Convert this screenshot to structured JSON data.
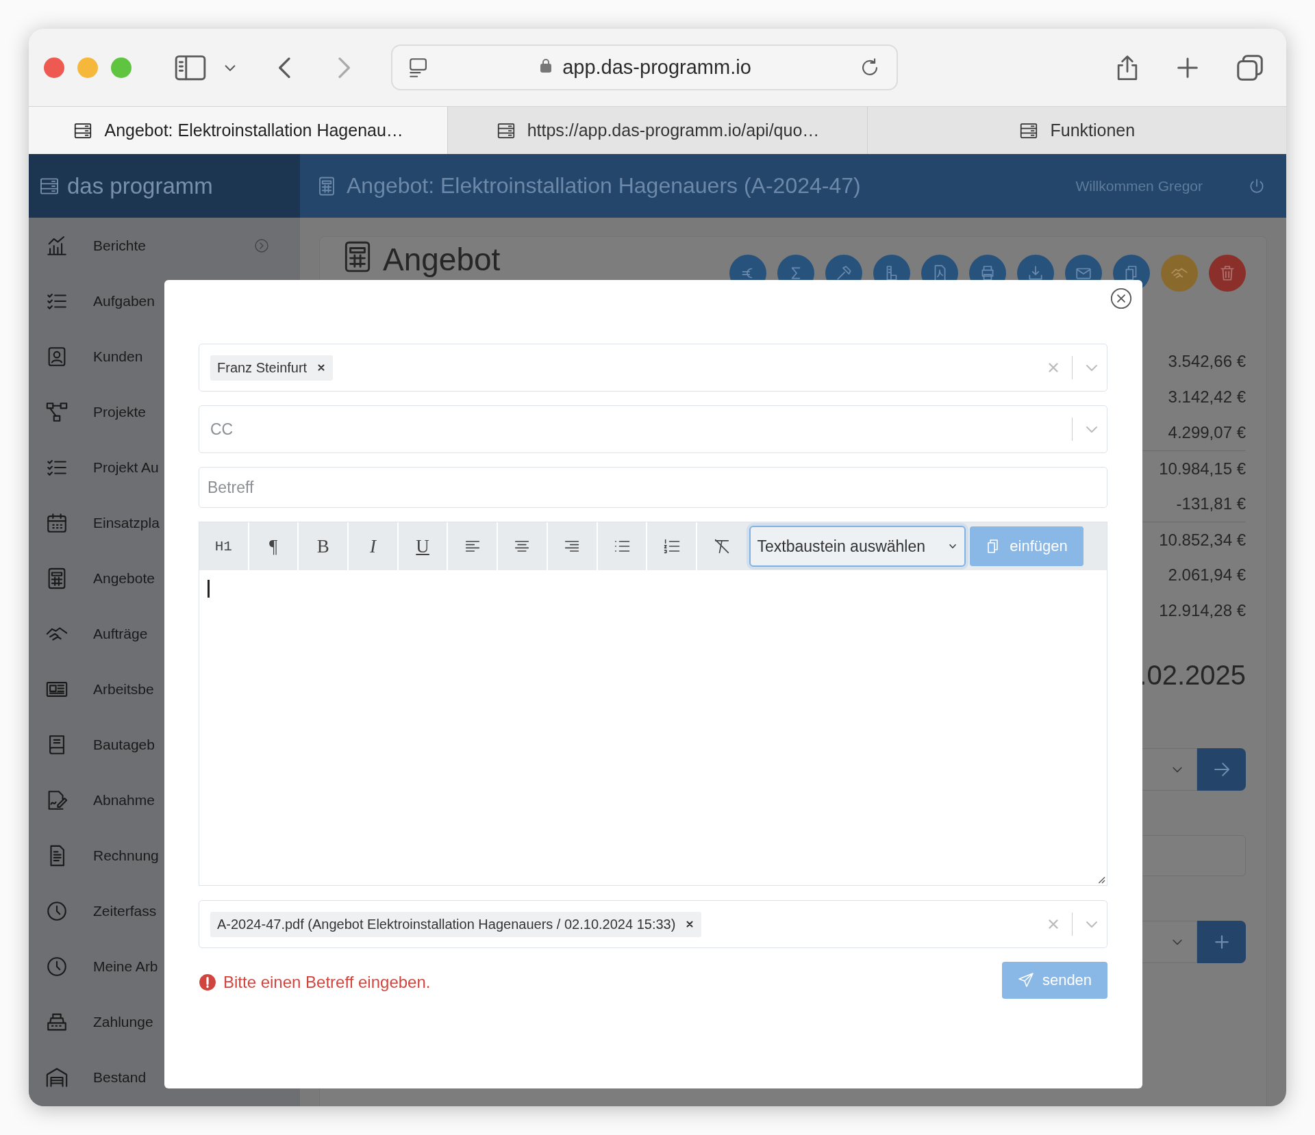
{
  "browser": {
    "address": "app.das-programm.io",
    "tabs": [
      {
        "label": "Angebot: Elektroinstallation Hagenau…",
        "selected": true
      },
      {
        "label": "https://app.das-programm.io/api/quo…",
        "selected": false
      },
      {
        "label": "Funktionen",
        "selected": false
      }
    ]
  },
  "app": {
    "brand": "das programm",
    "title": "Angebot: Elektroinstallation Hagenauers (A-2024-47)",
    "welcome": "Willkommen Gregor"
  },
  "sidebar": {
    "items": [
      {
        "label": "Berichte",
        "submenu": true
      },
      {
        "label": "Aufgaben"
      },
      {
        "label": "Kunden"
      },
      {
        "label": "Projekte"
      },
      {
        "label": "Projekt Au"
      },
      {
        "label": "Einsatzpla"
      },
      {
        "label": "Angebote"
      },
      {
        "label": "Aufträge"
      },
      {
        "label": "Arbeitsbe"
      },
      {
        "label": "Bautageb"
      },
      {
        "label": "Abnahme"
      },
      {
        "label": "Rechnung"
      },
      {
        "label": "Zeiterfass"
      },
      {
        "label": "Meine Arb"
      },
      {
        "label": "Zahlunge"
      },
      {
        "label": "Bestand"
      }
    ]
  },
  "page": {
    "heading": "Angebot",
    "amounts": [
      {
        "value": "3.542,66 €",
        "rule_above": false
      },
      {
        "value": "3.142,42 €",
        "rule_above": false
      },
      {
        "value": "4.299,07 €",
        "rule_above": false
      },
      {
        "value": "10.984,15 €",
        "rule_above": true
      },
      {
        "value": "-131,81 €",
        "rule_above": false
      },
      {
        "value": "10.852,34 €",
        "rule_above": true
      },
      {
        "value": "2.061,94 €",
        "rule_above": false
      },
      {
        "value": "12.914,28 €",
        "rule_above": false
      }
    ],
    "date": ".02.2025"
  },
  "email_dialog": {
    "recipients": [
      "Franz Steinfurt"
    ],
    "cc": {
      "placeholder": "CC"
    },
    "subject": {
      "placeholder": "Betreff"
    },
    "text_buttons": [
      "H1",
      "¶",
      "B",
      "I",
      "U"
    ],
    "snippet_select": {
      "value": "Textbaustein auswählen"
    },
    "insert_button": {
      "label": "einfügen",
      "disabled": true
    },
    "attachments": [
      "A-2024-47.pdf (Angebot Elektroinstallation Hagenauers / 02.10.2024 15:33)"
    ],
    "error": "Bitte einen Betreff eingeben.",
    "send_button": {
      "label": "senden",
      "disabled": true
    }
  }
}
